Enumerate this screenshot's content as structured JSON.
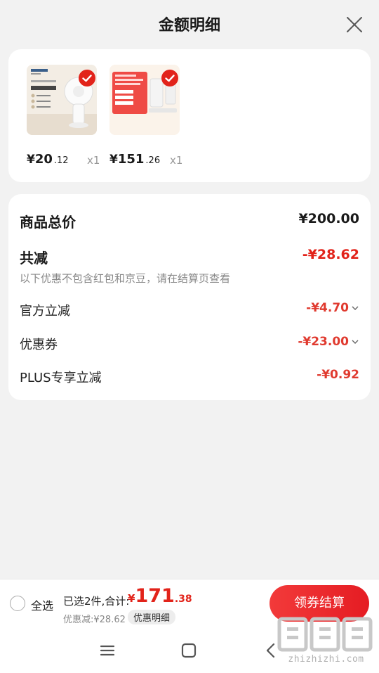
{
  "header": {
    "title": "金额明细"
  },
  "products": [
    {
      "price_int": "20",
      "price_dec": ".12",
      "qty": "x1",
      "thumb_kind": "fan"
    },
    {
      "price_int": "151",
      "price_dec": ".26",
      "qty": "x1",
      "thumb_kind": "charger"
    }
  ],
  "currency": "¥",
  "summary": {
    "total_label": "商品总价",
    "total_value": "¥200.00",
    "reduce_label": "共减",
    "reduce_value": "-¥28.62",
    "note": "以下优惠不包含红包和京豆，请在结算页查看",
    "items": [
      {
        "label": "官方立减",
        "value": "-¥4.70",
        "expandable": true
      },
      {
        "label": "优惠券",
        "value": "-¥23.00",
        "expandable": true
      },
      {
        "label": "PLUS专享立减",
        "value": "-¥0.92",
        "expandable": false
      }
    ]
  },
  "bottom": {
    "select_all": "全选",
    "selected_info": "已选2件,合计:",
    "total_int": "171",
    "total_dec": ".38",
    "discount_info": "优惠减:¥28.62",
    "detail_chip": "优惠明细",
    "checkout": "领券结算"
  },
  "watermark": {
    "text": "zhizhizhi.com"
  },
  "colors": {
    "accent": "#e2231a",
    "background": "#f2f2f2",
    "card": "#ffffff"
  }
}
